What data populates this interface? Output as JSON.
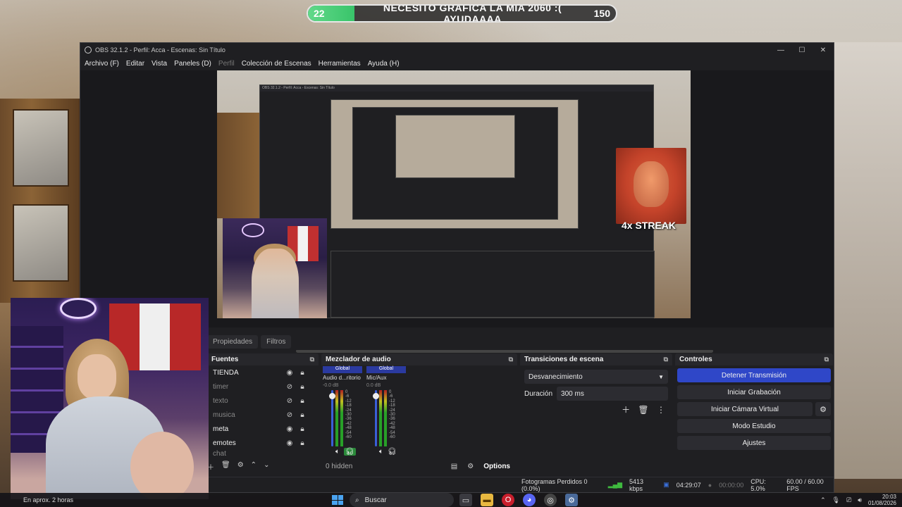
{
  "alert": {
    "left_num": "22",
    "message": "NECESITO GRAFICA LA MIA 2060 :( AYUDAAAA",
    "right_num": "150",
    "progress": 0.15
  },
  "window": {
    "title": "OBS 32.1.2 - Perfil: Acca - Escenas: Sin Título",
    "controls": [
      "—",
      "☐",
      "✕"
    ]
  },
  "menu": [
    {
      "label": "Archivo (F)",
      "enabled": true
    },
    {
      "label": "Editar",
      "enabled": true
    },
    {
      "label": "Vista",
      "enabled": true
    },
    {
      "label": "Paneles (D)",
      "enabled": true
    },
    {
      "label": "Perfil",
      "enabled": false
    },
    {
      "label": "Colección de Escenas",
      "enabled": true
    },
    {
      "label": "Herramientas",
      "enabled": true
    },
    {
      "label": "Ayuda (H)",
      "enabled": true
    }
  ],
  "preview": {
    "streak_text": "4x STREAK"
  },
  "tabs": [
    "Propiedades",
    "Filtros"
  ],
  "sources": {
    "title": "Fuentes",
    "items": [
      {
        "name": "TIENDA",
        "visible": true
      },
      {
        "name": "timer",
        "visible": false
      },
      {
        "name": "texto",
        "visible": false
      },
      {
        "name": "musica",
        "visible": false
      },
      {
        "name": "meta",
        "visible": true
      },
      {
        "name": "emotes",
        "visible": true
      },
      {
        "name": "chat",
        "visible": false
      }
    ]
  },
  "mixer": {
    "title": "Mezclador de audio",
    "channels": [
      {
        "badge": "Global",
        "name": "Audio d...ritorio",
        "db": "-0.0 dB",
        "level": 0.95
      },
      {
        "badge": "Global",
        "name": "Mic/Aux",
        "db": "0.0 dB",
        "level": 0.95
      }
    ],
    "scale": [
      "0",
      "-6",
      "-12",
      "-18",
      "-24",
      "-30",
      "-36",
      "-42",
      "-48",
      "-54",
      "-60"
    ],
    "hidden_label": "0 hidden",
    "options_label": "Options"
  },
  "transitions": {
    "title": "Transiciones de escena",
    "selected": "Desvanecimiento",
    "duration_label": "Duración",
    "duration_value": "300 ms"
  },
  "controls": {
    "title": "Controles",
    "buttons": [
      "Detener Transmisión",
      "Iniciar Grabación",
      "Iniciar Cámara Virtual",
      "Modo Estudio",
      "Ajustes"
    ]
  },
  "status": {
    "dropped": "Fotogramas Perdidos 0 (0.0%)",
    "bitrate": "5413 kbps",
    "live_time": "04:29:07",
    "rec_time": "00:00:00",
    "cpu": "CPU: 5.0%",
    "fps": "60.00 / 60.00 FPS"
  },
  "taskbar": {
    "weather": "En aprox. 2 horas",
    "search_placeholder": "Buscar",
    "time": "20:03",
    "date": "01/08/2026"
  }
}
